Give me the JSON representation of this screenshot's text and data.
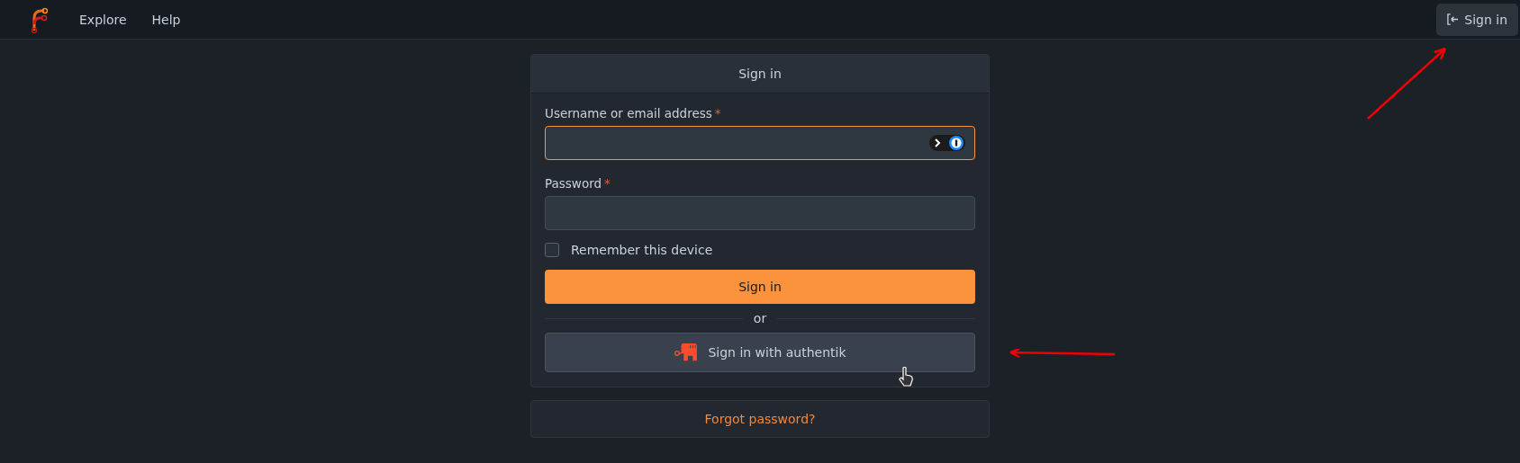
{
  "navbar": {
    "links": [
      {
        "label": "Explore"
      },
      {
        "label": "Help"
      }
    ],
    "sign_in_button": "Sign in"
  },
  "login_card": {
    "title": "Sign in",
    "fields": [
      {
        "label": "Username or email address",
        "required_mark": "*",
        "focused": true,
        "password_manager_badge": true
      },
      {
        "label": "Password",
        "required_mark": "*",
        "focused": false,
        "password_manager_badge": false
      }
    ],
    "remember": {
      "label": "Remember this device",
      "checked": false
    },
    "submit_button": "Sign in",
    "divider_text": "or",
    "oauth_button": "Sign in with authentik"
  },
  "forgot_link": "Forgot password?"
}
